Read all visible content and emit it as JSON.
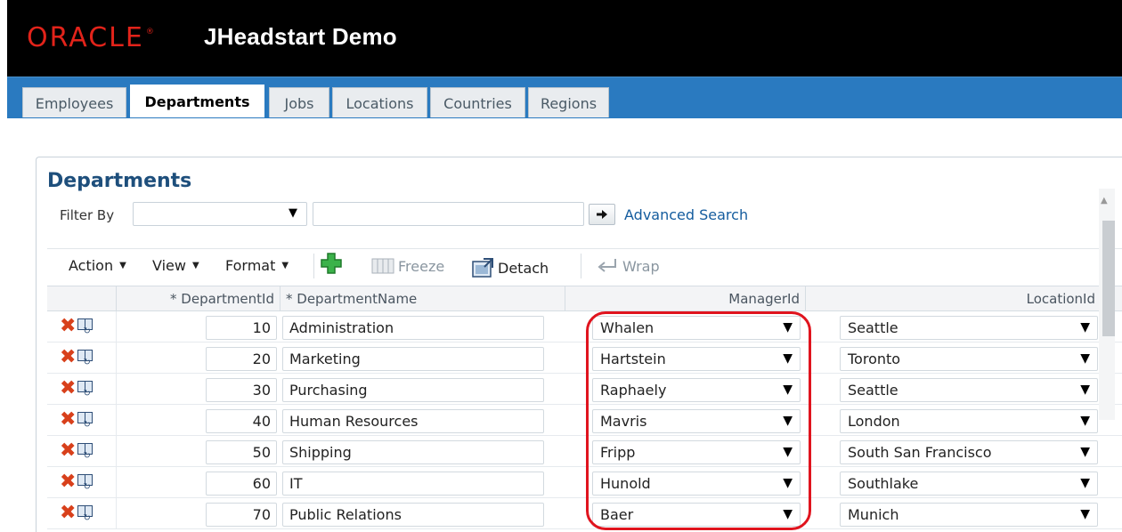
{
  "header": {
    "brand": "ORACLE",
    "title": "JHeadstart Demo"
  },
  "tabs": [
    {
      "label": "Employees",
      "active": false
    },
    {
      "label": "Departments",
      "active": true
    },
    {
      "label": "Jobs",
      "active": false
    },
    {
      "label": "Locations",
      "active": false
    },
    {
      "label": "Countries",
      "active": false
    },
    {
      "label": "Regions",
      "active": false
    }
  ],
  "panel": {
    "title": "Departments",
    "filter_label": "Filter By",
    "filter_select_value": "",
    "filter_input_value": "",
    "advanced_search": "Advanced Search"
  },
  "toolbar": {
    "action": "Action",
    "view": "View",
    "format": "Format",
    "freeze": "Freeze",
    "detach": "Detach",
    "wrap": "Wrap"
  },
  "columns": {
    "department_id": "* DepartmentId",
    "department_name": "* DepartmentName",
    "manager_id": "ManagerId",
    "location_id": "LocationId"
  },
  "rows": [
    {
      "id": "10",
      "name": "Administration",
      "manager": "Whalen",
      "location": "Seattle"
    },
    {
      "id": "20",
      "name": "Marketing",
      "manager": "Hartstein",
      "location": "Toronto"
    },
    {
      "id": "30",
      "name": "Purchasing",
      "manager": "Raphaely",
      "location": "Seattle"
    },
    {
      "id": "40",
      "name": "Human Resources",
      "manager": "Mavris",
      "location": "London"
    },
    {
      "id": "50",
      "name": "Shipping",
      "manager": "Fripp",
      "location": "South San Francisco"
    },
    {
      "id": "60",
      "name": "IT",
      "manager": "Hunold",
      "location": "Southlake"
    },
    {
      "id": "70",
      "name": "Public Relations",
      "manager": "Baer",
      "location": "Munich"
    }
  ],
  "colors": {
    "header_bg": "#000000",
    "brand_red": "#e2231a",
    "tab_bar_blue": "#2a7ac0",
    "title_blue": "#1e4f7c",
    "link_blue": "#145c9e",
    "highlight_red": "#e0141e"
  }
}
